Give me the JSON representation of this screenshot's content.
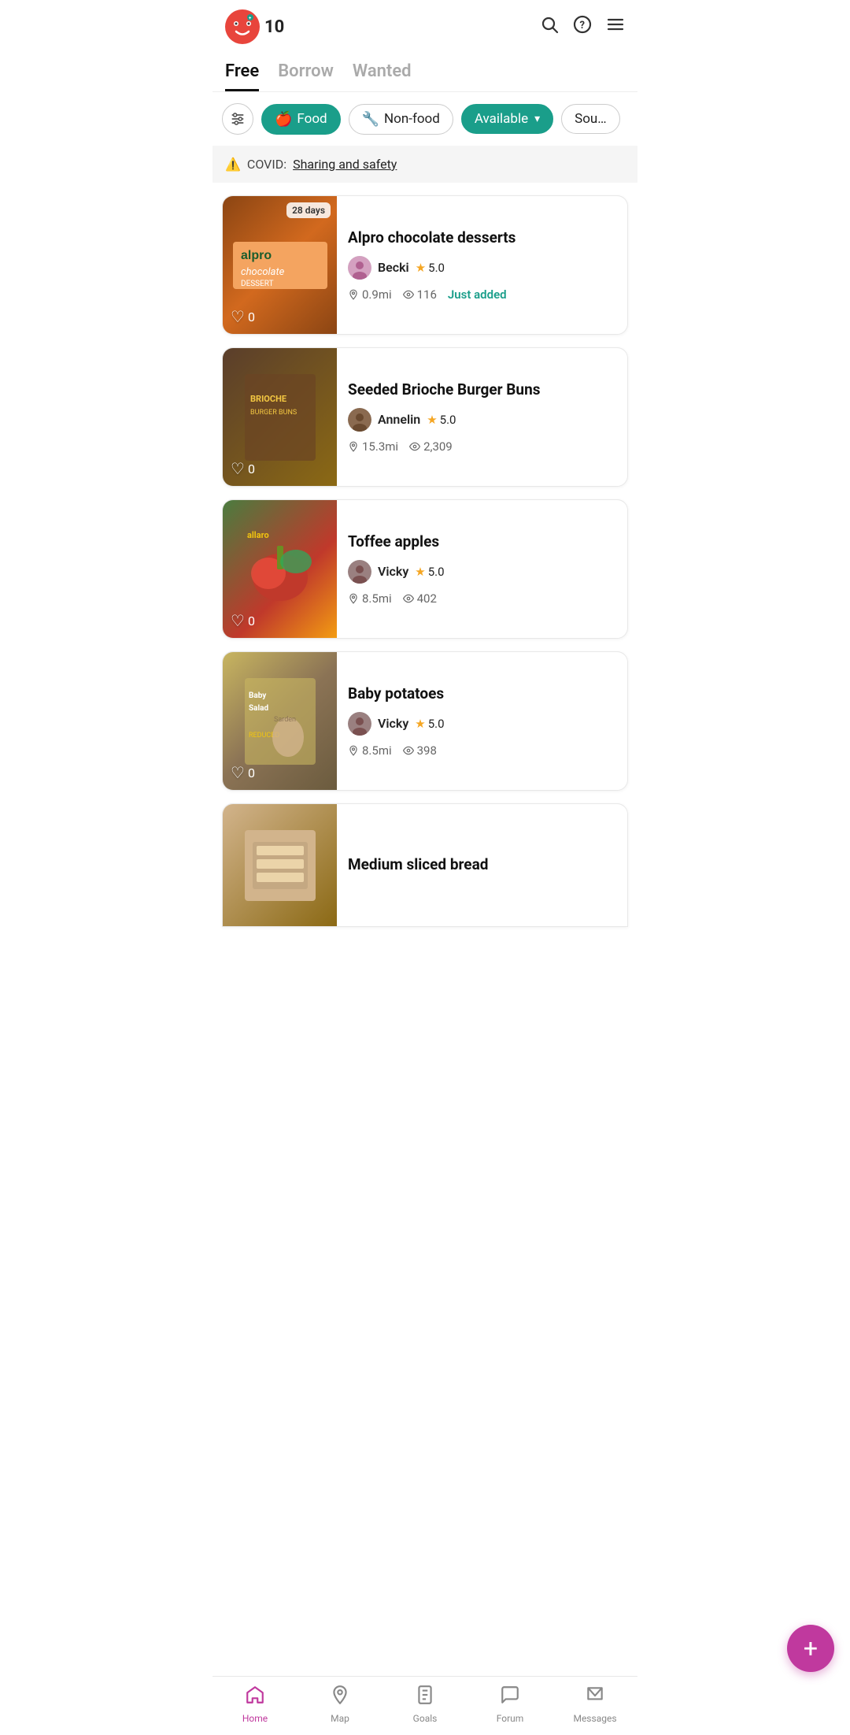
{
  "app": {
    "notification_count": "10",
    "title": "OLIO"
  },
  "header": {
    "search_icon": "search",
    "help_icon": "help",
    "menu_icon": "menu"
  },
  "tabs": [
    {
      "id": "free",
      "label": "Free",
      "active": true
    },
    {
      "id": "borrow",
      "label": "Borrow",
      "active": false
    },
    {
      "id": "wanted",
      "label": "Wanted",
      "active": false
    }
  ],
  "filters": {
    "filter_icon": "sliders",
    "chips": [
      {
        "id": "food",
        "label": "Food",
        "icon": "🍎",
        "active": true
      },
      {
        "id": "non-food",
        "label": "Non-food",
        "icon": "🔧",
        "active": false
      },
      {
        "id": "available",
        "label": "Available",
        "active": true,
        "dropdown": true
      },
      {
        "id": "sort",
        "label": "Sou…",
        "active": false
      }
    ]
  },
  "covid_banner": {
    "warning_icon": "⚠️",
    "text": "COVID:",
    "link_text": "Sharing and safety"
  },
  "listings": [
    {
      "id": 1,
      "title": "Alpro chocolate desserts",
      "user_name": "Becki",
      "user_rating": "5.0",
      "distance": "0.9mi",
      "views": "116",
      "tag": "Just added",
      "tag_color": "#1a9e8a",
      "likes": "0",
      "days_badge": "28 days",
      "image_type": "alpro"
    },
    {
      "id": 2,
      "title": "Seeded Brioche Burger Buns",
      "user_name": "Annelin",
      "user_rating": "5.0",
      "distance": "15.3mi",
      "views": "2,309",
      "tag": "",
      "likes": "0",
      "image_type": "brioche"
    },
    {
      "id": 3,
      "title": "Toffee apples",
      "user_name": "Vicky",
      "user_rating": "5.0",
      "distance": "8.5mi",
      "views": "402",
      "tag": "",
      "likes": "0",
      "image_type": "toffee"
    },
    {
      "id": 4,
      "title": "Baby potatoes",
      "user_name": "Vicky",
      "user_rating": "5.0",
      "distance": "8.5mi",
      "views": "398",
      "tag": "",
      "likes": "0",
      "image_type": "potatoes"
    },
    {
      "id": 5,
      "title": "Medium sliced bread",
      "user_name": "",
      "distance": "",
      "views": "",
      "image_type": "bread"
    }
  ],
  "fab": {
    "label": "+"
  },
  "bottom_nav": [
    {
      "id": "home",
      "label": "Home",
      "icon": "home",
      "active": true
    },
    {
      "id": "map",
      "label": "Map",
      "icon": "map",
      "active": false
    },
    {
      "id": "goals",
      "label": "Goals",
      "icon": "goals",
      "active": false
    },
    {
      "id": "forum",
      "label": "Forum",
      "icon": "forum",
      "active": false
    },
    {
      "id": "messages",
      "label": "Messages",
      "icon": "messages",
      "active": false
    }
  ]
}
